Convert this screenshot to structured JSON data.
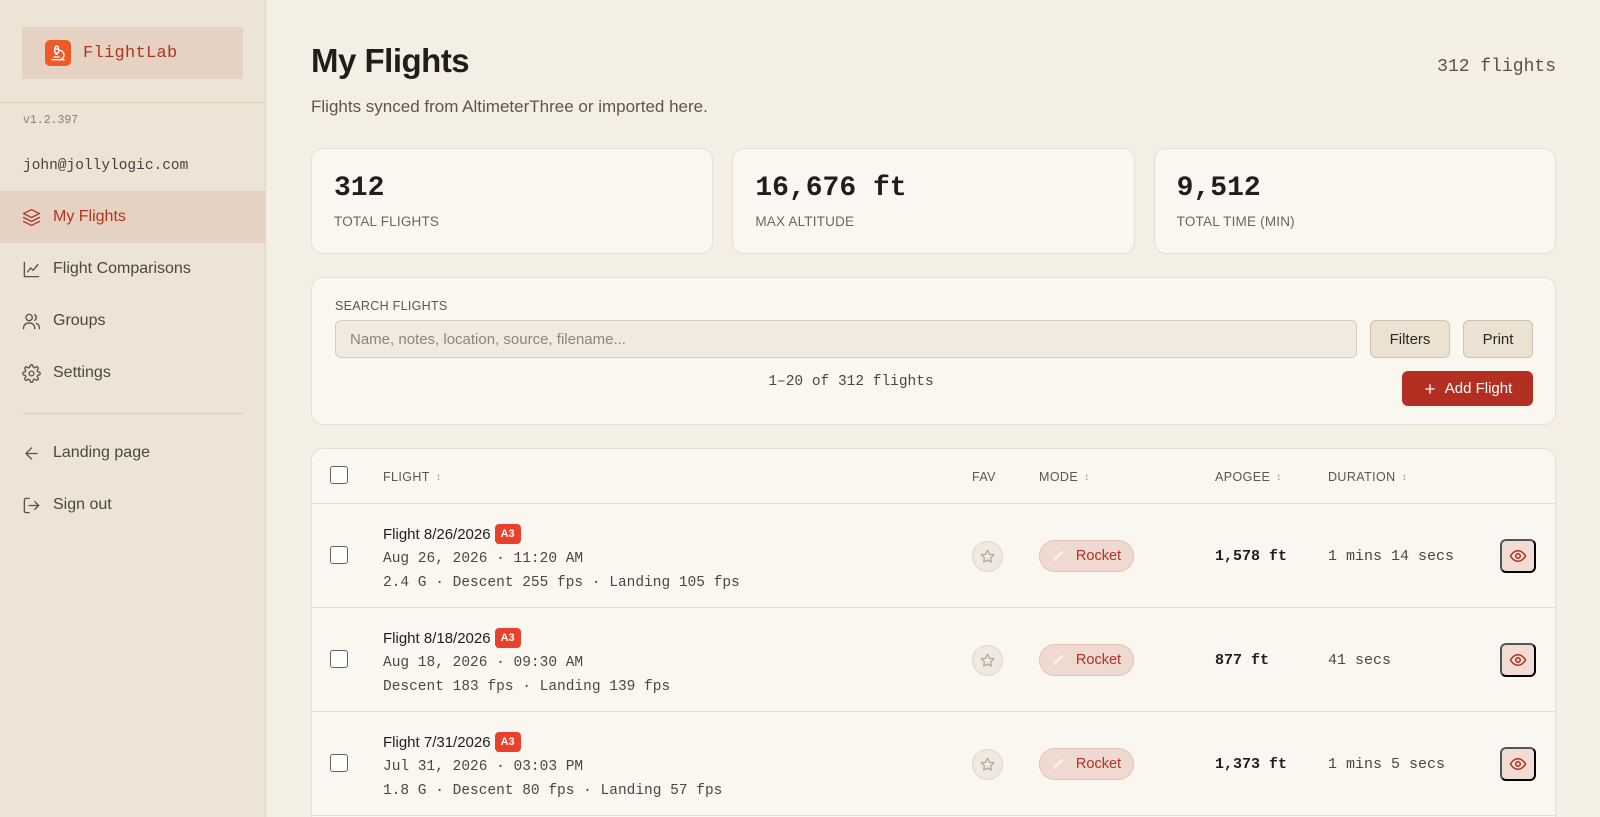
{
  "brand": {
    "name": "FlightLab"
  },
  "sidebar": {
    "version": "v1.2.397",
    "email": "john@jollylogic.com",
    "items": [
      {
        "label": "My Flights",
        "icon": "layers-icon",
        "active": true
      },
      {
        "label": "Flight Comparisons",
        "icon": "chart-line-icon",
        "active": false
      },
      {
        "label": "Groups",
        "icon": "users-icon",
        "active": false
      },
      {
        "label": "Settings",
        "icon": "gear-icon",
        "active": false
      }
    ],
    "footer_items": [
      {
        "label": "Landing page",
        "icon": "arrow-left-icon"
      },
      {
        "label": "Sign out",
        "icon": "sign-out-icon"
      }
    ]
  },
  "header": {
    "title": "My Flights",
    "count": "312 flights",
    "subtitle": "Flights synced from AltimeterThree or imported here."
  },
  "stats": [
    {
      "value": "312",
      "label": "TOTAL FLIGHTS"
    },
    {
      "value": "16,676 ft",
      "label": "MAX ALTITUDE"
    },
    {
      "value": "9,512",
      "label": "TOTAL TIME (MIN)"
    }
  ],
  "search": {
    "label": "SEARCH FLIGHTS",
    "placeholder": "Name, notes, location, source, filename...",
    "value": "",
    "filters_label": "Filters",
    "print_label": "Print",
    "range_text": "1–20 of 312 flights",
    "add_label": "Add Flight"
  },
  "table": {
    "columns": {
      "flight": "FLIGHT",
      "fav": "FAV",
      "mode": "MODE",
      "apogee": "APOGEE",
      "duration": "DURATION"
    },
    "rows": [
      {
        "title": "Flight 8/26/2026",
        "badge": "A3",
        "date": "Aug 26, 2026 · 11:20 AM",
        "meta": "2.4 G · Descent 255 fps · Landing 105 fps",
        "mode": "Rocket",
        "apogee": "1,578 ft",
        "duration": "1 mins 14 secs"
      },
      {
        "title": "Flight 8/18/2026",
        "badge": "A3",
        "date": "Aug 18, 2026 · 09:30 AM",
        "meta": "Descent 183 fps · Landing 139 fps",
        "mode": "Rocket",
        "apogee": "877 ft",
        "duration": "41 secs"
      },
      {
        "title": "Flight 7/31/2026",
        "badge": "A3",
        "date": "Jul 31, 2026 · 03:03 PM",
        "meta": "1.8 G · Descent 80 fps · Landing 57 fps",
        "mode": "Rocket",
        "apogee": "1,373 ft",
        "duration": "1 mins 5 secs"
      }
    ]
  },
  "colors": {
    "accent": "#b32f21",
    "badge": "#e8412e",
    "sidebar_bg": "#ede4d5",
    "page_bg": "#f4efe5"
  }
}
